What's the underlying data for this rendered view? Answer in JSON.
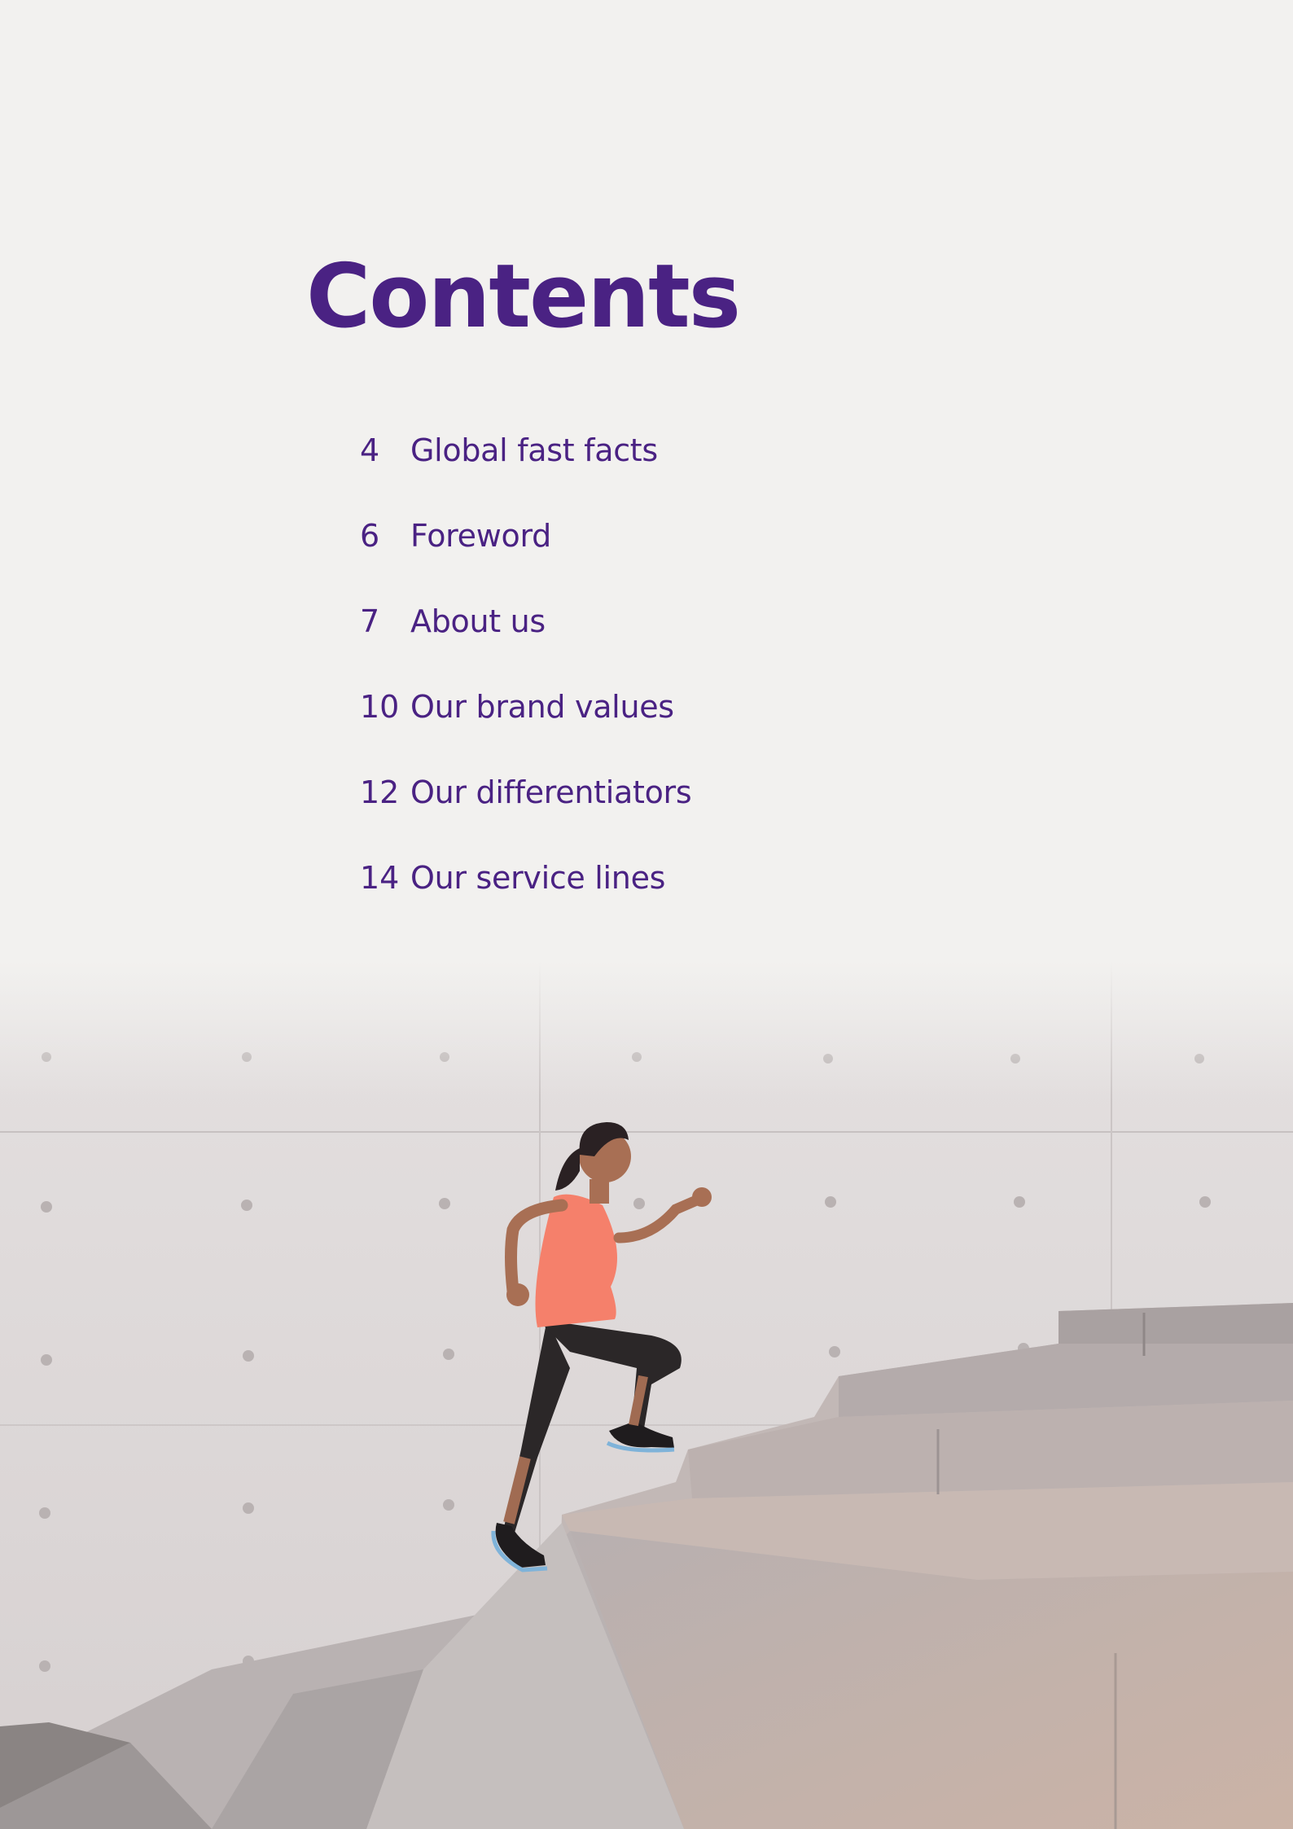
{
  "page": {
    "title": "Contents",
    "accent_color": "#4a2283",
    "background_color": "#f2f1ef"
  },
  "toc": {
    "items": [
      {
        "page": "4",
        "label": "Global fast facts"
      },
      {
        "page": "6",
        "label": "Foreword"
      },
      {
        "page": "7",
        "label": "About us"
      },
      {
        "page": "10",
        "label": "Our brand values"
      },
      {
        "page": "12",
        "label": "Our differentiators"
      },
      {
        "page": "14",
        "label": "Our service lines"
      }
    ]
  },
  "hero_image": {
    "subject": "woman-running-up-stairs-photo"
  }
}
